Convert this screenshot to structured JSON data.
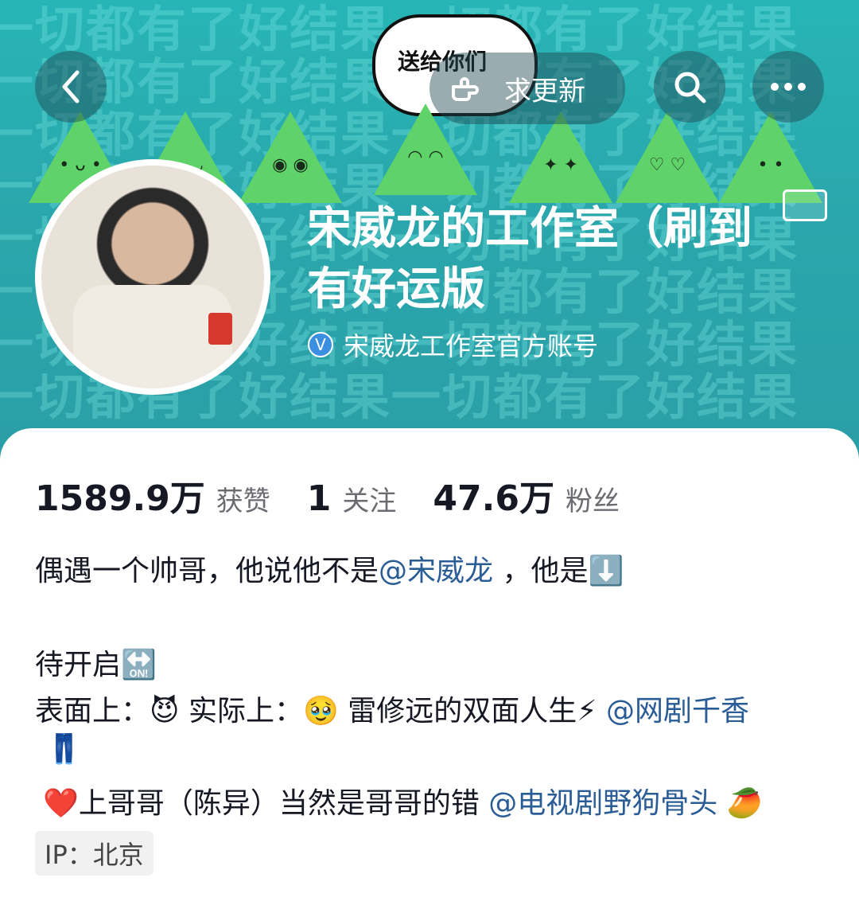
{
  "banner": {
    "bg_text_row": "一切都有了好结果一切都有了好结果",
    "bubble_text": "送给你们"
  },
  "nav": {
    "back_icon": "chevron-left-icon",
    "update_label": "求更新",
    "search_icon": "search-icon",
    "more_icon": "more-icon"
  },
  "profile": {
    "name_line1": "宋威龙的工作室（刷到",
    "name_line2": "有好运版",
    "verify_text": "宋威龙工作室官方账号",
    "accent_color": "#2a5c96"
  },
  "stats": {
    "likes_num": "1589.9万",
    "likes_label": "获赞",
    "following_num": "1",
    "following_label": "关注",
    "fans_num": "47.6万",
    "fans_label": "粉丝"
  },
  "bio": {
    "line1_a": "偶遇一个帅哥，他说他不是",
    "line1_mention": "@宋威龙",
    "line1_b": " ，他是⬇️",
    "line2": "待开启🔛",
    "line3_a": "表面上：😈 实际上：🥹 雷修远的双面人生⚡ ",
    "line3_mention": "@网剧千香",
    "line4": "👖",
    "line5_a": "❤️上哥哥（陈异）当然是哥哥的错 ",
    "line5_mention": "@电视剧野狗骨头",
    "line5_b": " 🥭"
  },
  "ip": {
    "label": "IP：北京"
  }
}
